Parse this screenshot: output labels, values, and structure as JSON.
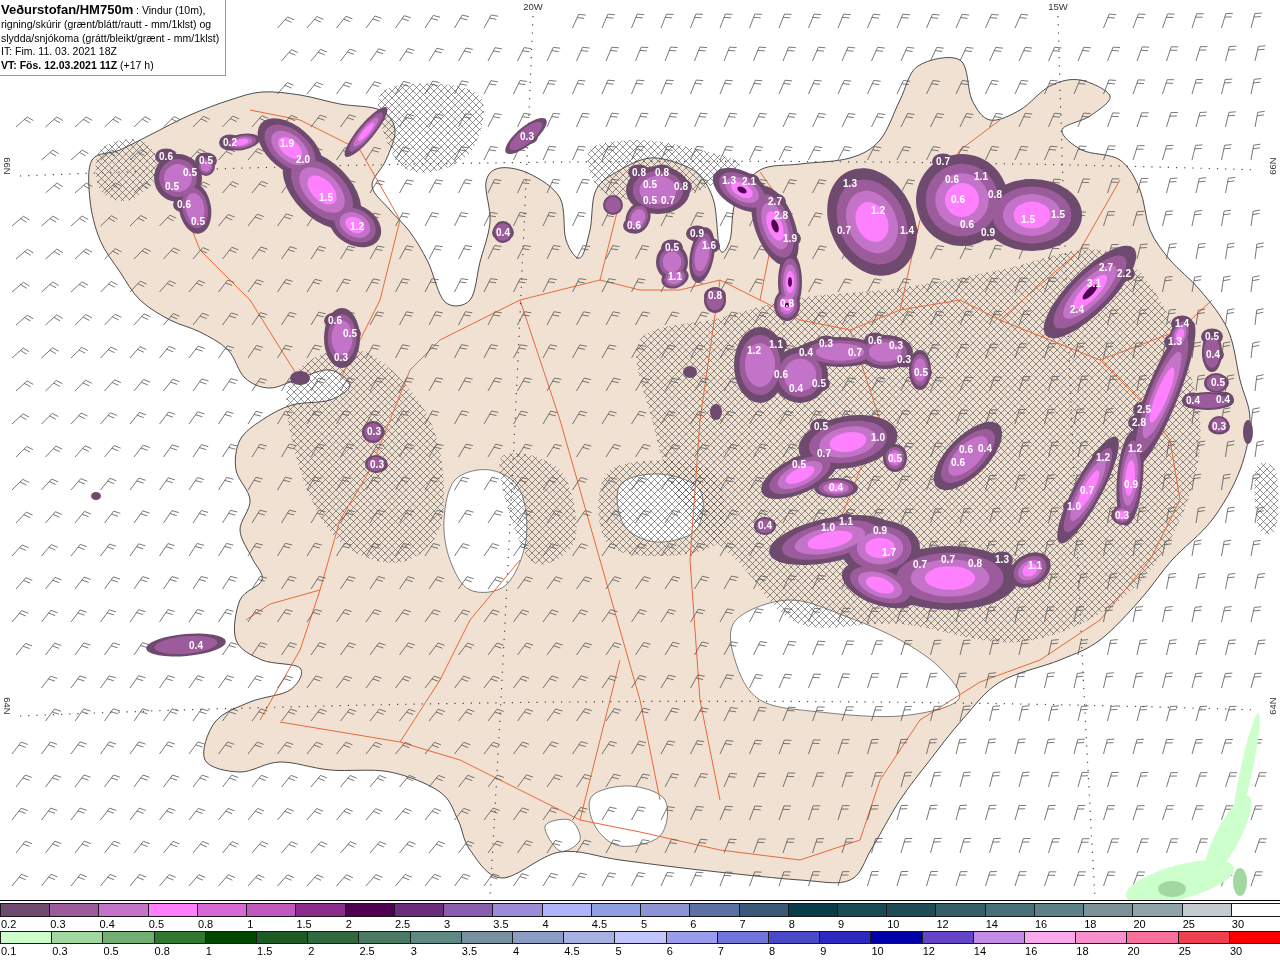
{
  "header": {
    "title_line": "**Veðurstofan/HM750m** : Vindur (10m),",
    "lines": [
      "rigning/skúrir (grænt/blátt/rautt - mm/1klst) og",
      "slydda/snjókoma (grátt/bleikt/grænt - mm/1klst)",
      "IT: Fim. 11. 03. 2021 18Z",
      "**VT: Fös. 12.03.2021 11Z** (+17 h)"
    ]
  },
  "map": {
    "longitude_labels": [
      "20W",
      "15W"
    ],
    "latitude_labels_left": [
      "66N",
      "64N"
    ],
    "latitude_labels_right": [
      "66N",
      "64N"
    ],
    "precipitation_areas": [
      {
        "values": [
          "0.6",
          "0.5",
          "0.5",
          "0.5",
          "0.6",
          "0.5"
        ]
      },
      {
        "values": [
          "0.2",
          "1.9",
          "2.0",
          "1.5",
          "1.2"
        ]
      },
      {
        "values": [
          "0.6",
          "0.5",
          "0.3"
        ]
      },
      {
        "values": [
          "0.3"
        ]
      },
      {
        "values": [
          "0.4"
        ]
      },
      {
        "values": [
          "0.8",
          "0.8",
          "0.5",
          "0.8",
          "0.5",
          "0.7",
          "0.6"
        ]
      },
      {
        "values": [
          "0.9",
          "1.6",
          "0.5",
          "1.1"
        ]
      },
      {
        "values": [
          "0.8"
        ]
      },
      {
        "values": [
          "1.3",
          "2.1",
          "2.7",
          "2.8",
          "1.9",
          "0.8"
        ]
      },
      {
        "values": [
          "1.3",
          "1.2",
          "0.7",
          "1.4"
        ]
      },
      {
        "values": [
          "0.7",
          "0.6",
          "1.1",
          "0.8",
          "0.6",
          "0.6",
          "0.9",
          "1.5",
          "1.5"
        ]
      },
      {
        "values": [
          "2.7",
          "2.2",
          "3.1",
          "2.4"
        ]
      },
      {
        "values": [
          "1.2",
          "1.1",
          "0.4",
          "0.3",
          "0.7",
          "0.6",
          "0.3",
          "0.3",
          "0.6",
          "0.4",
          "0.5",
          "0.5"
        ]
      },
      {
        "values": [
          "0.5",
          "1.0",
          "0.7",
          "0.5",
          "0.5",
          "0.4"
        ]
      },
      {
        "values": [
          "0.6",
          "0.4",
          "0.6"
        ]
      },
      {
        "values": [
          "0.4"
        ]
      },
      {
        "values": [
          "1.0",
          "1.1",
          "0.9",
          "1.7",
          "0.7",
          "0.7",
          "0.8",
          "1.3",
          "1.1"
        ]
      },
      {
        "values": [
          "1.4",
          "1.3",
          "2.5",
          "2.8",
          "1.2",
          "0.9",
          "0.3"
        ]
      },
      {
        "values": [
          "1.2",
          "0.7",
          "1.0"
        ]
      },
      {
        "values": [
          "0.5",
          "0.4",
          "0.5",
          "0.4",
          "0.4",
          "0.3"
        ]
      },
      {
        "values": [
          "0.3",
          "0.3"
        ]
      },
      {
        "values": [
          "0.4"
        ]
      }
    ]
  },
  "legends": [
    {
      "items": [
        {
          "label": "0.2",
          "color": "#6e4a6e"
        },
        {
          "label": "0.3",
          "color": "#9c5c9c"
        },
        {
          "label": "0.4",
          "color": "#c474c8"
        },
        {
          "label": "0.5",
          "color": "#ff80ff"
        },
        {
          "label": "0.8",
          "color": "#d868d8"
        },
        {
          "label": "1",
          "color": "#c058c0"
        },
        {
          "label": "1.5",
          "color": "#8c2c8c"
        },
        {
          "label": "2",
          "color": "#500050"
        },
        {
          "label": "2.5",
          "color": "#6c2c7c"
        },
        {
          "label": "3",
          "color": "#8a5cb0"
        },
        {
          "label": "3.5",
          "color": "#9c8cd8"
        },
        {
          "label": "4",
          "color": "#b0b4fc"
        },
        {
          "label": "4.5",
          "color": "#90a0e0"
        },
        {
          "label": "5",
          "color": "#8c94d4"
        },
        {
          "label": "6",
          "color": "#5c70a4"
        },
        {
          "label": "7",
          "color": "#3c5878"
        },
        {
          "label": "8",
          "color": "#083c48"
        },
        {
          "label": "9",
          "color": "#184a54"
        },
        {
          "label": "10",
          "color": "#204c58"
        },
        {
          "label": "12",
          "color": "#345e68"
        },
        {
          "label": "14",
          "color": "#48707a"
        },
        {
          "label": "16",
          "color": "#5e8088"
        },
        {
          "label": "18",
          "color": "#7a9298"
        },
        {
          "label": "20",
          "color": "#8ea4a8"
        },
        {
          "label": "25",
          "color": "#c4ccd0"
        },
        {
          "label": "30",
          "color": "#ffffff"
        }
      ]
    },
    {
      "items": [
        {
          "label": "0.1",
          "color": "#ccffcc"
        },
        {
          "label": "0.3",
          "color": "#a0d8a0"
        },
        {
          "label": "0.5",
          "color": "#70b070"
        },
        {
          "label": "0.8",
          "color": "#307830"
        },
        {
          "label": "1",
          "color": "#004800"
        },
        {
          "label": "1.5",
          "color": "#1c5c24"
        },
        {
          "label": "2",
          "color": "#306840"
        },
        {
          "label": "2.5",
          "color": "#4a7a64"
        },
        {
          "label": "3",
          "color": "#5e8882"
        },
        {
          "label": "3.5",
          "color": "#7890a0"
        },
        {
          "label": "4",
          "color": "#8c9cc4"
        },
        {
          "label": "4.5",
          "color": "#a8b0e4"
        },
        {
          "label": "5",
          "color": "#c4c4ff"
        },
        {
          "label": "6",
          "color": "#9c9cec"
        },
        {
          "label": "7",
          "color": "#7074dc"
        },
        {
          "label": "8",
          "color": "#4a4ac8"
        },
        {
          "label": "9",
          "color": "#2c28c0"
        },
        {
          "label": "10",
          "color": "#0000a8"
        },
        {
          "label": "12",
          "color": "#6444c8"
        },
        {
          "label": "14",
          "color": "#c08ce8"
        },
        {
          "label": "16",
          "color": "#f8a8ec"
        },
        {
          "label": "18",
          "color": "#f890cc"
        },
        {
          "label": "20",
          "color": "#f8709c"
        },
        {
          "label": "25",
          "color": "#f04050"
        },
        {
          "label": "30",
          "color": "#fc0000"
        }
      ]
    }
  ]
}
